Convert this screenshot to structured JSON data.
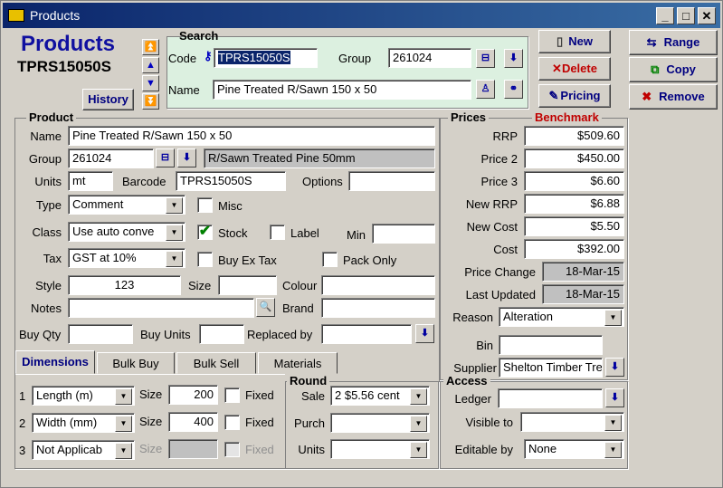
{
  "window": {
    "title": "Products"
  },
  "header": {
    "title": "Products",
    "code": "TPRS15050S",
    "history": "History"
  },
  "search": {
    "title": "Search",
    "code_label": "Code",
    "code_value": "TPRS15050S",
    "group_label": "Group",
    "group_value": "261024",
    "name_label": "Name",
    "name_value": "Pine Treated R/Sawn 150 x 50"
  },
  "actions": {
    "new": "New",
    "delete": "Delete",
    "pricing": "Pricing",
    "range": "Range",
    "copy": "Copy",
    "remove": "Remove"
  },
  "product": {
    "title": "Product",
    "name_label": "Name",
    "name_value": "Pine Treated R/Sawn 150 x 50",
    "group_label": "Group",
    "group_value": "261024",
    "group_desc": "R/Sawn Treated Pine 50mm",
    "units_label": "Units",
    "units_value": "mt",
    "barcode_label": "Barcode",
    "barcode_value": "TPRS15050S",
    "options_label": "Options",
    "options_value": "",
    "type_label": "Type",
    "type_value": "Comment",
    "misc_label": "Misc",
    "class_label": "Class",
    "class_value": "Use auto conve",
    "stock_label": "Stock",
    "label_label": "Label",
    "min_label": "Min",
    "min_value": "",
    "tax_label": "Tax",
    "tax_value": "GST at 10%",
    "buyex_label": "Buy Ex Tax",
    "packonly_label": "Pack Only",
    "style_label": "Style",
    "style_value": "123",
    "size_label": "Size",
    "size_value": "",
    "colour_label": "Colour",
    "colour_value": "",
    "notes_label": "Notes",
    "notes_value": "",
    "brand_label": "Brand",
    "brand_value": "",
    "buyqty_label": "Buy Qty",
    "buyqty_value": "",
    "buyunits_label": "Buy Units",
    "buyunits_value": "",
    "replaced_label": "Replaced by",
    "replaced_value": ""
  },
  "prices": {
    "title": "Prices",
    "benchmark": "Benchmark",
    "rrp_label": "RRP",
    "rrp": "$509.60",
    "price2_label": "Price 2",
    "price2": "$450.00",
    "price3_label": "Price 3",
    "price3": "$6.60",
    "newrrp_label": "New RRP",
    "newrrp": "$6.88",
    "newcost_label": "New Cost",
    "newcost": "$5.50",
    "cost_label": "Cost",
    "cost": "$392.00",
    "pricechange_label": "Price Change",
    "pricechange": "18-Mar-15",
    "lastupdated_label": "Last Updated",
    "lastupdated": "18-Mar-15",
    "reason_label": "Reason",
    "reason": "Alteration",
    "bin_label": "Bin",
    "bin": "",
    "supplier_label": "Supplier",
    "supplier": "Shelton Timber Tre"
  },
  "tabs": [
    {
      "label": "Dimensions"
    },
    {
      "label": "Bulk Buy"
    },
    {
      "label": "Bulk Sell"
    },
    {
      "label": "Materials"
    }
  ],
  "dimensions": {
    "rows": [
      {
        "num": "1",
        "type": "Length (m)",
        "size_label": "Size",
        "size": "200",
        "fixed": "Fixed"
      },
      {
        "num": "2",
        "type": "Width (mm)",
        "size_label": "Size",
        "size": "400",
        "fixed": "Fixed"
      },
      {
        "num": "3",
        "type": "Not Applicab",
        "size_label": "Size",
        "size": "",
        "fixed": "Fixed"
      }
    ]
  },
  "round": {
    "title": "Round",
    "sale_label": "Sale",
    "sale": "2  $5.56 cent",
    "purch_label": "Purch",
    "purch": "",
    "units_label": "Units",
    "units": ""
  },
  "access": {
    "title": "Access",
    "ledger_label": "Ledger",
    "ledger": "",
    "visible_label": "Visible to",
    "visible": "",
    "editable_label": "Editable by",
    "editable": "None"
  }
}
